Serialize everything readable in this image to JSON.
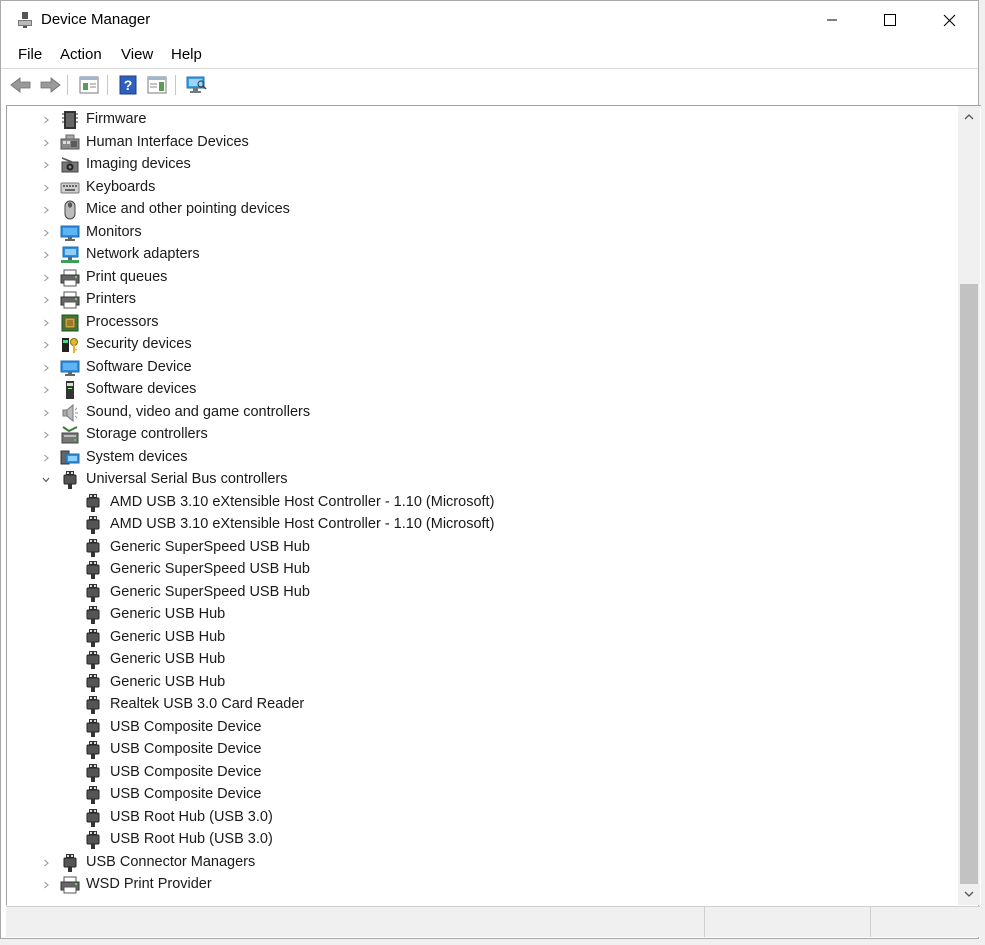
{
  "window": {
    "title": "Device Manager",
    "controls": {
      "minimize": "minimize",
      "maximize": "maximize",
      "close": "close"
    }
  },
  "menu": [
    "File",
    "Action",
    "View",
    "Help"
  ],
  "toolbar": {
    "buttons": [
      {
        "name": "back-arrow-icon"
      },
      {
        "name": "forward-arrow-icon"
      },
      {
        "name": "properties-icon"
      },
      {
        "name": "help-icon"
      },
      {
        "name": "show-hide-console-tree-icon"
      },
      {
        "name": "scan-for-hardware-changes-icon"
      }
    ]
  },
  "tree": {
    "categories": [
      {
        "label": "Firmware",
        "icon": "firmware-icon",
        "expanded": false
      },
      {
        "label": "Human Interface Devices",
        "icon": "hid-icon",
        "expanded": false
      },
      {
        "label": "Imaging devices",
        "icon": "camera-icon",
        "expanded": false
      },
      {
        "label": "Keyboards",
        "icon": "keyboard-icon",
        "expanded": false
      },
      {
        "label": "Mice and other pointing devices",
        "icon": "mouse-icon",
        "expanded": false
      },
      {
        "label": "Monitors",
        "icon": "monitor-icon",
        "expanded": false
      },
      {
        "label": "Network adapters",
        "icon": "network-icon",
        "expanded": false
      },
      {
        "label": "Print queues",
        "icon": "printer-icon",
        "expanded": false
      },
      {
        "label": "Printers",
        "icon": "printer-icon",
        "expanded": false
      },
      {
        "label": "Processors",
        "icon": "processor-icon",
        "expanded": false
      },
      {
        "label": "Security devices",
        "icon": "security-key-icon",
        "expanded": false
      },
      {
        "label": "Software Device",
        "icon": "monitor-icon",
        "expanded": false
      },
      {
        "label": "Software devices",
        "icon": "software-device-icon",
        "expanded": false
      },
      {
        "label": "Sound, video and game controllers",
        "icon": "speaker-icon",
        "expanded": false
      },
      {
        "label": "Storage controllers",
        "icon": "storage-icon",
        "expanded": false
      },
      {
        "label": "System devices",
        "icon": "system-icon",
        "expanded": false
      },
      {
        "label": "Universal Serial Bus controllers",
        "icon": "usb-icon",
        "expanded": true,
        "children": [
          "AMD USB 3.10 eXtensible Host Controller - 1.10 (Microsoft)",
          "AMD USB 3.10 eXtensible Host Controller - 1.10 (Microsoft)",
          "Generic SuperSpeed USB Hub",
          "Generic SuperSpeed USB Hub",
          "Generic SuperSpeed USB Hub",
          "Generic USB Hub",
          "Generic USB Hub",
          "Generic USB Hub",
          "Generic USB Hub",
          "Realtek USB 3.0 Card Reader",
          "USB Composite Device",
          "USB Composite Device",
          "USB Composite Device",
          "USB Composite Device",
          "USB Root Hub (USB 3.0)",
          "USB Root Hub (USB 3.0)"
        ]
      },
      {
        "label": "USB Connector Managers",
        "icon": "usb-icon",
        "expanded": false
      },
      {
        "label": "WSD Print Provider",
        "icon": "printer-icon",
        "expanded": false
      }
    ]
  },
  "colors": {
    "accent_blue": "#1e88e5",
    "selection": "#cce8ff",
    "text": "#1a1a1a"
  }
}
